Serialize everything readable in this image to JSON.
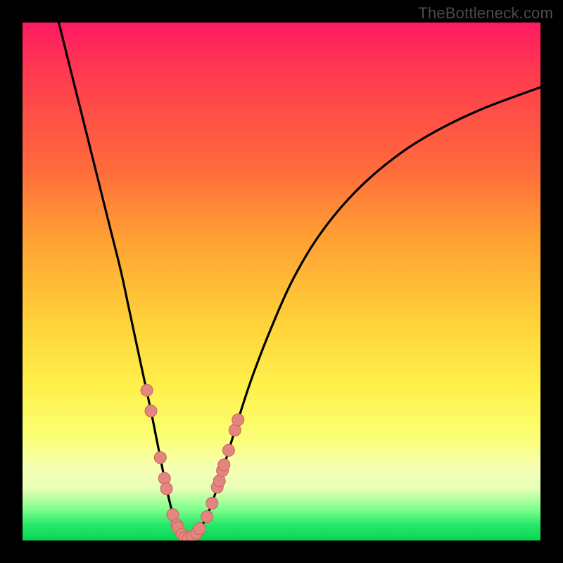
{
  "watermark": "TheBottleneck.com",
  "colors": {
    "frame": "#000000",
    "curve": "#000000",
    "marker_fill": "#e4857f",
    "marker_stroke": "#c9635c",
    "gradient_top": "#ff1a62",
    "gradient_bottom": "#08d553"
  },
  "chart_data": {
    "type": "line",
    "title": "",
    "xlabel": "",
    "ylabel": "",
    "xlim": [
      0,
      100
    ],
    "ylim": [
      0,
      100
    ],
    "grid": false,
    "legend": false,
    "curve_left_xy": [
      [
        7,
        100
      ],
      [
        9,
        92
      ],
      [
        11,
        84
      ],
      [
        13,
        76
      ],
      [
        15,
        68
      ],
      [
        17,
        60
      ],
      [
        19,
        52
      ],
      [
        20.5,
        45
      ],
      [
        22,
        38
      ],
      [
        23.5,
        31
      ],
      [
        24.8,
        25
      ],
      [
        25.8,
        20
      ],
      [
        26.8,
        15
      ],
      [
        27.6,
        11
      ],
      [
        28.4,
        7.5
      ],
      [
        29.2,
        4.5
      ],
      [
        30,
        2.5
      ],
      [
        31,
        1.0
      ],
      [
        31.9,
        0.2
      ]
    ],
    "curve_right_xy": [
      [
        31.9,
        0.2
      ],
      [
        33.5,
        1.2
      ],
      [
        35,
        3.5
      ],
      [
        36.5,
        7
      ],
      [
        38,
        11.5
      ],
      [
        40,
        18
      ],
      [
        42,
        24.5
      ],
      [
        44.5,
        32
      ],
      [
        48,
        41
      ],
      [
        52,
        50
      ],
      [
        57,
        58.5
      ],
      [
        63,
        66
      ],
      [
        70,
        72.5
      ],
      [
        78,
        78
      ],
      [
        88,
        83
      ],
      [
        100,
        87.5
      ]
    ],
    "markers_xy": [
      [
        24.0,
        29.0
      ],
      [
        24.8,
        25.0
      ],
      [
        26.6,
        16.0
      ],
      [
        27.4,
        12.0
      ],
      [
        27.8,
        10.0
      ],
      [
        29.0,
        5.0
      ],
      [
        29.8,
        3.0
      ],
      [
        30.0,
        2.5
      ],
      [
        30.8,
        1.2
      ],
      [
        31.3,
        0.6
      ],
      [
        32.0,
        0.4
      ],
      [
        32.8,
        0.8
      ],
      [
        33.6,
        1.4
      ],
      [
        34.2,
        2.3
      ],
      [
        35.6,
        4.6
      ],
      [
        36.6,
        7.2
      ],
      [
        37.6,
        10.3
      ],
      [
        38.0,
        11.5
      ],
      [
        38.6,
        13.5
      ],
      [
        38.9,
        14.6
      ],
      [
        39.8,
        17.4
      ],
      [
        41.0,
        21.3
      ],
      [
        41.6,
        23.3
      ]
    ],
    "vertex_x": 31.9,
    "notes": "Axes are unlabeled in the source image; values are approximate readings in 0–100 normalized coordinates from pixel positions. The chart depicts a V-shaped bottleneck curve with scattered pink data markers clustered around the valley, over a vertical red→green heat gradient."
  }
}
